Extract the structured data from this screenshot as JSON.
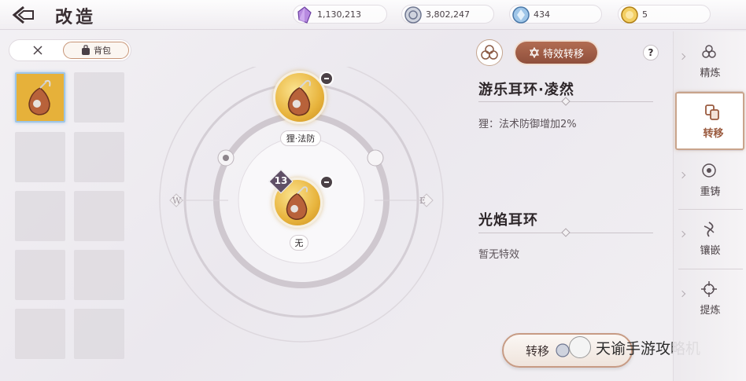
{
  "header": {
    "title": "改造"
  },
  "currencies": [
    {
      "icon": "purple-crystal-icon",
      "value": "1,130,213"
    },
    {
      "icon": "silver-coin-icon",
      "value": "3,802,247"
    },
    {
      "icon": "blue-gem-icon",
      "value": "434"
    },
    {
      "icon": "gold-token-icon",
      "value": "5"
    }
  ],
  "bag": {
    "tab_label": "背包",
    "all_icon": "crossed-swords-icon",
    "bag_icon": "backpack-icon"
  },
  "dial": {
    "top_item_label": "狸·法防",
    "center_item_label": "无",
    "center_item_level": "13",
    "compass_west": "W",
    "compass_east": "E"
  },
  "panel": {
    "effect_tab_label": "特效转移",
    "help_label": "?",
    "source_name": "游乐耳环·凌然",
    "source_effect": "狸：法术防御增加2%",
    "target_name": "光焰耳环",
    "target_effect": "暂无特效",
    "transfer_label": "转移"
  },
  "watermark": {
    "text": "天谕手游攻略机"
  },
  "sidenav": {
    "items": [
      {
        "label": "精炼",
        "icon": "refine-icon"
      },
      {
        "label": "转移",
        "icon": "transfer-icon"
      },
      {
        "label": "重铸",
        "icon": "recast-icon"
      },
      {
        "label": "镶嵌",
        "icon": "inlay-icon"
      },
      {
        "label": "提炼",
        "icon": "extract-icon"
      }
    ],
    "active_index": 1
  },
  "colors": {
    "accent": "#9a5a3e",
    "gold": "#e8b43d",
    "selected_border": "#9ec5e6"
  }
}
